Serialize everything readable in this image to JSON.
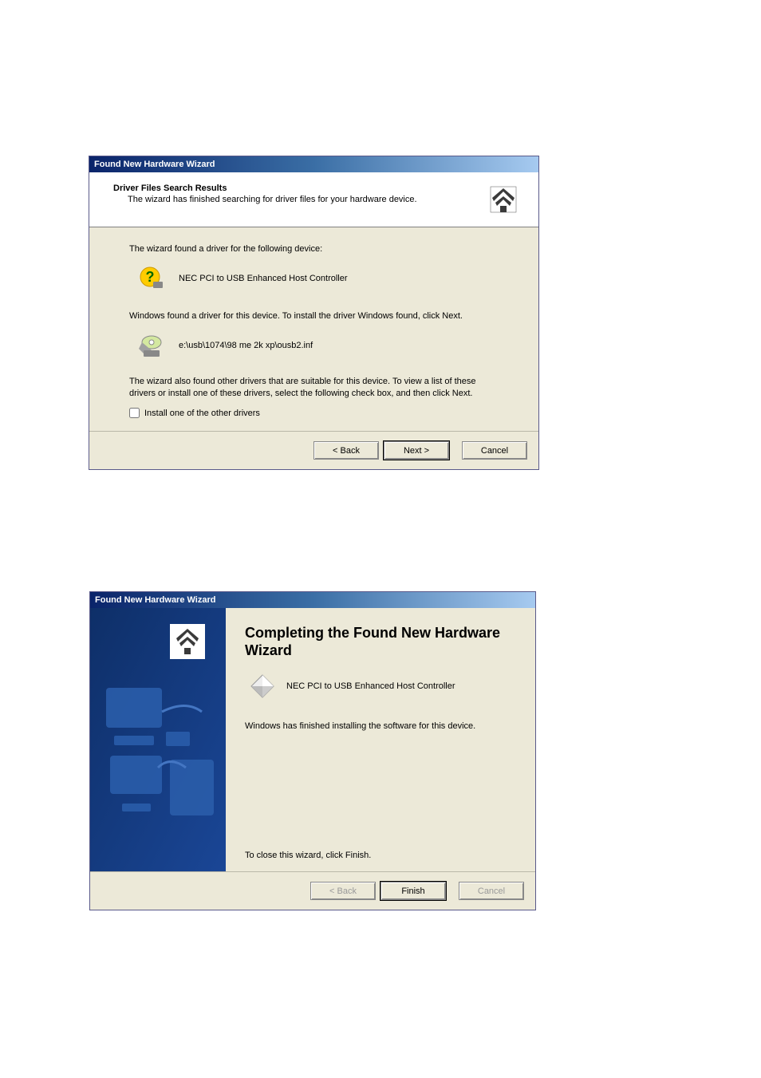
{
  "dialog1": {
    "title": "Found New Hardware Wizard",
    "header": {
      "title": "Driver Files Search Results",
      "subtitle": "The wizard has finished searching for driver files for your hardware device."
    },
    "content": {
      "found_text": "The wizard found a driver for the following device:",
      "device_name": "NEC PCI to USB Enhanced Host Controller",
      "install_text": "Windows found a driver for this device. To install the driver Windows found, click Next.",
      "driver_path": "e:\\usb\\1074\\98 me 2k xp\\ousb2.inf",
      "other_drivers_text": "The wizard also found other drivers that are suitable for this device. To view a list of these drivers or install one of these drivers, select the following check box, and then click Next.",
      "checkbox_label": "Install one of the other drivers"
    },
    "buttons": {
      "back": "< Back",
      "next": "Next >",
      "cancel": "Cancel"
    }
  },
  "dialog2": {
    "title": "Found New Hardware Wizard",
    "header": {
      "completion_title": "Completing the Found New Hardware Wizard",
      "device_name": "NEC PCI to USB Enhanced Host Controller",
      "finished_text": "Windows has finished installing the software for this device.",
      "close_text": "To close this wizard, click Finish."
    },
    "buttons": {
      "back": "< Back",
      "finish": "Finish",
      "cancel": "Cancel"
    }
  }
}
